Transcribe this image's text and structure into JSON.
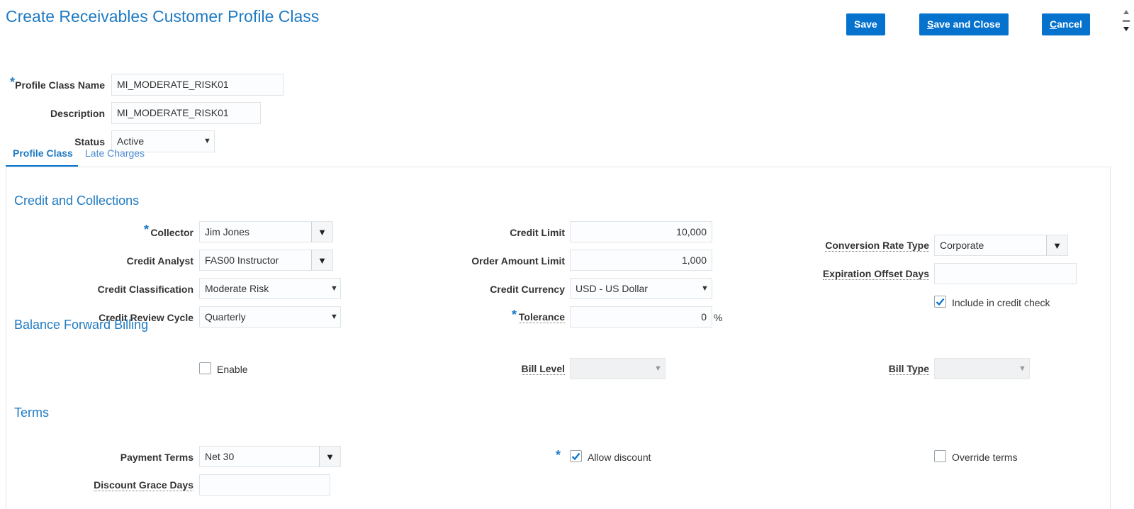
{
  "header": {
    "title": "Create Receivables Customer Profile Class",
    "save": "Save",
    "save_and_close_prefix": "S",
    "save_and_close_rest": "ave and Close",
    "cancel_prefix": "C",
    "cancel_rest": "ancel"
  },
  "profile": {
    "name_label": "Profile Class Name",
    "name_value": "MI_MODERATE_RISK01",
    "description_label": "Description",
    "description_value": "MI_MODERATE_RISK01",
    "status_label": "Status",
    "status_value": "Active"
  },
  "tabs": [
    {
      "label": "Profile Class",
      "active": true
    },
    {
      "label": "Late Charges",
      "active": false
    }
  ],
  "credit": {
    "section_title": "Credit and Collections",
    "collector_label": "Collector",
    "collector_value": "Jim Jones",
    "analyst_label": "Credit Analyst",
    "analyst_value": "FAS00 Instructor",
    "classification_label": "Credit Classification",
    "classification_value": "Moderate Risk",
    "review_cycle_label": "Credit Review Cycle",
    "review_cycle_value": "Quarterly",
    "limit_label": "Credit Limit",
    "limit_value": "10,000",
    "order_limit_label": "Order Amount Limit",
    "order_limit_value": "1,000",
    "currency_label": "Credit Currency",
    "currency_value": "USD - US Dollar",
    "tolerance_label": "Tolerance",
    "tolerance_value": "0",
    "tolerance_unit": "%",
    "conversion_label": "Conversion Rate Type",
    "conversion_value": "Corporate",
    "expiration_label": "Expiration Offset Days",
    "expiration_value": "",
    "include_credit_check_label": "Include in credit check",
    "include_credit_check": true
  },
  "balance": {
    "section_title": "Balance Forward Billing",
    "enable_label": "Enable",
    "enable": false,
    "bill_level_label": "Bill Level",
    "bill_level_value": "",
    "bill_type_label": "Bill Type",
    "bill_type_value": ""
  },
  "terms": {
    "section_title": "Terms",
    "payment_terms_label": "Payment Terms",
    "payment_terms_value": "Net 30",
    "allow_discount_label": "Allow discount",
    "allow_discount": true,
    "override_terms_label": "Override terms",
    "override_terms": false,
    "grace_days_label": "Discount Grace Days",
    "grace_days_value": ""
  },
  "colors": {
    "accent": "#0572ce",
    "heading": "#1f7ac2"
  },
  "icons": {
    "dropdown": "caret-down-icon",
    "checkbox": "checkmark-icon"
  }
}
